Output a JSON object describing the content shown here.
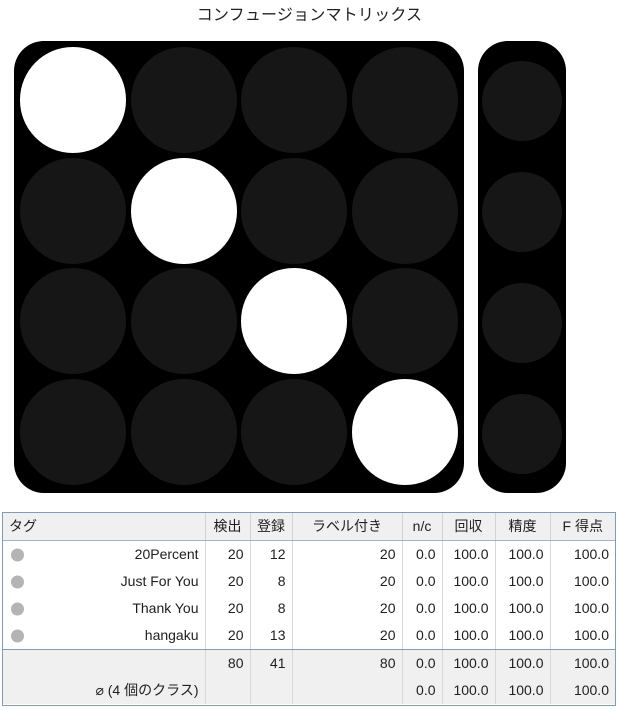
{
  "title": "コンフュージョンマトリックス",
  "matrix": {
    "class_labels": [
      "20Percent",
      "Just For You",
      "Thank You",
      "hangaku"
    ],
    "value_max": 20,
    "cells": [
      [
        20,
        0,
        0,
        0
      ],
      [
        0,
        20,
        0,
        0
      ],
      [
        0,
        0,
        20,
        0
      ],
      [
        0,
        0,
        0,
        20
      ]
    ],
    "nc_column": [
      0,
      0,
      0,
      0
    ],
    "colors": {
      "panel_background": "#000000",
      "cell_zero": "#161616",
      "cell_full": "#ffffff"
    }
  },
  "chart_data": {
    "type": "heatmap",
    "title": "コンフュージョンマトリックス",
    "xlabel": "",
    "ylabel": "",
    "x_categories": [
      "20Percent",
      "Just For You",
      "Thank You",
      "hangaku"
    ],
    "y_categories": [
      "20Percent",
      "Just For You",
      "Thank You",
      "hangaku"
    ],
    "values": [
      [
        20,
        0,
        0,
        0
      ],
      [
        0,
        20,
        0,
        0
      ],
      [
        0,
        0,
        20,
        0
      ],
      [
        0,
        0,
        0,
        20
      ]
    ],
    "extra_column": {
      "name": "n/c",
      "values": [
        0,
        0,
        0,
        0
      ]
    },
    "vmin": 0,
    "vmax": 20,
    "grid": false,
    "legend": "none"
  },
  "table": {
    "headers": {
      "tag": "タグ",
      "detected": "検出",
      "registered": "登録",
      "labeled": "ラベル付き",
      "nc": "n/c",
      "recall": "回収",
      "precision": "精度",
      "fscore": "F 得点"
    },
    "rows": [
      {
        "tag": "20Percent",
        "detected": "20",
        "registered": "12",
        "labeled": "20",
        "nc": "0.0",
        "recall": "100.0",
        "precision": "100.0",
        "fscore": "100.0"
      },
      {
        "tag": "Just For You",
        "detected": "20",
        "registered": "8",
        "labeled": "20",
        "nc": "0.0",
        "recall": "100.0",
        "precision": "100.0",
        "fscore": "100.0"
      },
      {
        "tag": "Thank You",
        "detected": "20",
        "registered": "8",
        "labeled": "20",
        "nc": "0.0",
        "recall": "100.0",
        "precision": "100.0",
        "fscore": "100.0"
      },
      {
        "tag": "hangaku",
        "detected": "20",
        "registered": "13",
        "labeled": "20",
        "nc": "0.0",
        "recall": "100.0",
        "precision": "100.0",
        "fscore": "100.0"
      }
    ],
    "summary": [
      {
        "tag": "",
        "detected": "80",
        "registered": "41",
        "labeled": "80",
        "nc": "0.0",
        "recall": "100.0",
        "precision": "100.0",
        "fscore": "100.0"
      },
      {
        "tag": "⌀ (4 個のクラス)",
        "detected": "",
        "registered": "",
        "labeled": "",
        "nc": "0.0",
        "recall": "100.0",
        "precision": "100.0",
        "fscore": "100.0"
      }
    ]
  }
}
